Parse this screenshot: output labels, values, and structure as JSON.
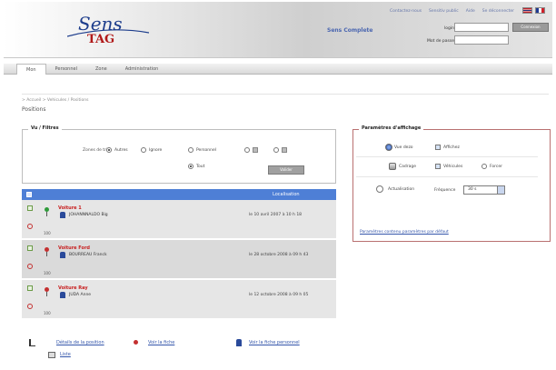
{
  "header": {
    "logo_text": "Sens",
    "logo_tag": "TAG",
    "top_links": [
      "Contactez-nous",
      "Sensitiv public",
      "Aide",
      "Se déconnecter"
    ],
    "app_name": "Sens Complete",
    "login_label": "login",
    "password_label": "Mot de passe",
    "connect_label": "Connexion",
    "flags": [
      "uk-flag-icon",
      "fr-flag-icon"
    ]
  },
  "menu": {
    "items": [
      "Mon",
      "Personnel",
      "Zone",
      "Administration"
    ]
  },
  "breadcrumb": "> Accueil > Vehicules / Positions",
  "page_title": "Positions",
  "filters": {
    "title": "Vu / Filtres",
    "label": "Zones de tri :",
    "options": [
      "Autres",
      "Ignore",
      "Personnel",
      "Tout"
    ],
    "validate_label": "Valider"
  },
  "list": {
    "location_header": "Localisation",
    "rows": [
      {
        "name": "Voiture 1",
        "person": "JOHANNNALDO Big",
        "code": "100",
        "date": "le 10 avril 2007 à 10 h 18"
      },
      {
        "name": "Voiture Ford",
        "person": "BOURREAU Franck",
        "code": "100",
        "date": "le 28 octobre 2008 à 09 h 43"
      },
      {
        "name": "Voiture Ray",
        "person": "JUDA Anne",
        "code": "100",
        "date": "le 12 octobre 2008 à 09 h 05"
      }
    ]
  },
  "footer": {
    "details_label": "Détails de la position",
    "sheet_label": "Voir la fiche",
    "personal_sheet_label": "Voir la fiche personnel",
    "list_label": "Liste"
  },
  "params": {
    "title": "Paramètres d'affichage",
    "rows": [
      {
        "button": "Vue dezo",
        "options": [
          "Affichez"
        ]
      },
      {
        "button": "Cadrage",
        "options": [
          "Véhicules",
          "Forcer"
        ]
      },
      {
        "button": "Actualisation",
        "refresh_label": "Fréquence",
        "refresh_value": "30 s"
      }
    ],
    "link": "Paramètres contenu paramètres par défaut"
  }
}
